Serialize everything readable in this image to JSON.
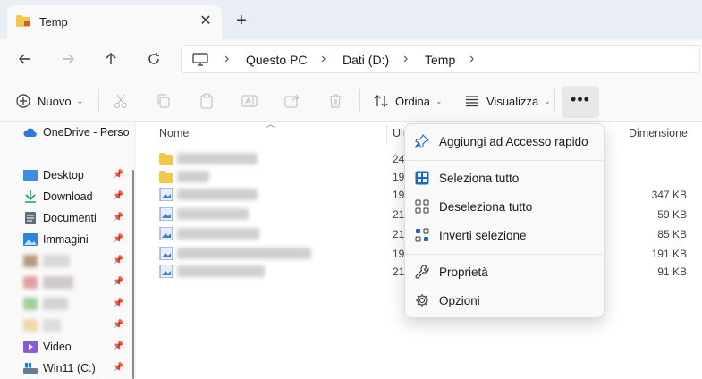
{
  "tab": {
    "title": "Temp",
    "close": "✕",
    "new_tab": "+"
  },
  "address": {
    "crumbs": [
      "Questo PC",
      "Dati (D:)",
      "Temp"
    ]
  },
  "commands": {
    "new_label": "Nuovo",
    "sort_label": "Ordina",
    "view_label": "Visualizza",
    "more": "•••"
  },
  "sidebar": {
    "items": [
      {
        "label": "OneDrive - Person"
      },
      {
        "label": "Desktop"
      },
      {
        "label": "Download"
      },
      {
        "label": "Documenti"
      },
      {
        "label": "Immagini"
      },
      {
        "label": "Video"
      },
      {
        "label": "Win11 (C:)"
      }
    ]
  },
  "columns": {
    "name": "Nome",
    "modified": "Ult",
    "size": "Dimensione"
  },
  "rows": [
    {
      "date": "24",
      "size": ""
    },
    {
      "date": "19",
      "size": ""
    },
    {
      "date": "19",
      "size": "347 KB"
    },
    {
      "date": "21",
      "size": "59 KB"
    },
    {
      "date": "21",
      "size": "85 KB"
    },
    {
      "date": "19",
      "size": "191 KB"
    },
    {
      "date": "21",
      "size": "91 KB"
    }
  ],
  "menu": {
    "pin": "Aggiungi ad Accesso rapido",
    "select_all": "Seleziona tutto",
    "deselect_all": "Deseleziona tutto",
    "invert": "Inverti selezione",
    "properties": "Proprietà",
    "options": "Opzioni"
  },
  "colors": {
    "accent": "#1a66c9",
    "folder": "#f4c64b",
    "tab_bg": "#e9eef5"
  }
}
